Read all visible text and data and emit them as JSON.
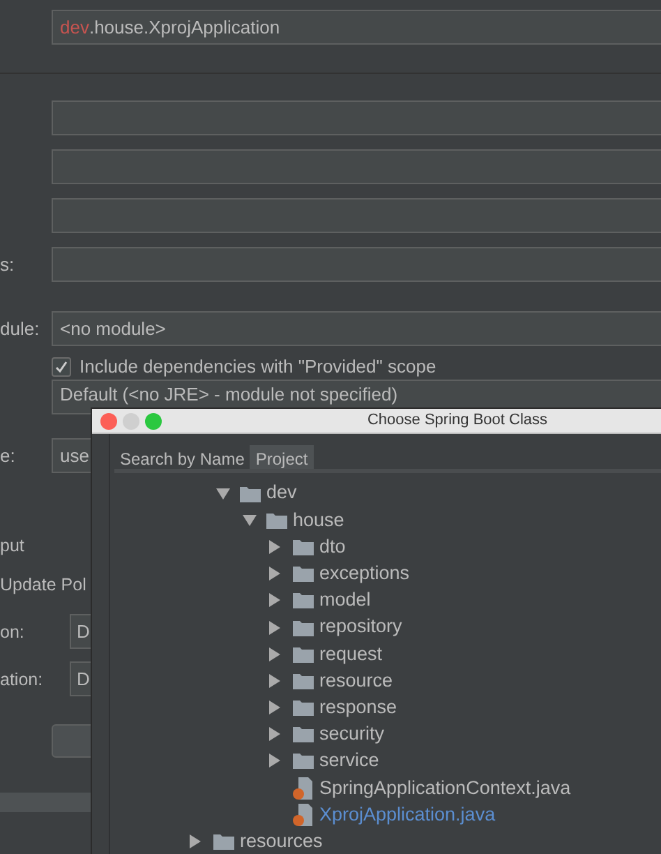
{
  "form": {
    "main_class": {
      "value": "**dev**.house.XprojApplication"
    },
    "fields": [
      {
        "kind": "text"
      },
      {
        "kind": "text"
      },
      {
        "kind": "text"
      },
      {
        "kind": "text",
        "label": "s:"
      }
    ],
    "module": {
      "label": "dule:",
      "value": "<no module>"
    },
    "include_provided": {
      "label": "Include dependencies with \"Provided\" scope",
      "checked": true
    },
    "jre": {
      "value": "Default (<no JRE> - module not specified)"
    },
    "shorten": {
      "label": "e:",
      "value": "use"
    },
    "lower_labels": [
      {
        "label": "put"
      },
      {
        "label": "Update Pol"
      },
      {
        "label": "on:",
        "value": "D"
      },
      {
        "label": "ation:",
        "value": "D"
      }
    ]
  },
  "dialog": {
    "title": "Choose Spring Boot Class",
    "tabs": [
      {
        "label": "Search by Name",
        "selected": false
      },
      {
        "label": "Project",
        "selected": true
      }
    ],
    "tree": [
      {
        "label": "dev",
        "kind": "folder",
        "expanded": true,
        "selected": false,
        "children": [
          {
            "label": "house",
            "kind": "folder",
            "expanded": true,
            "selected": false,
            "children": [
              {
                "label": "dto",
                "kind": "folder",
                "expanded": false,
                "selected": false
              },
              {
                "label": "exceptions",
                "kind": "folder",
                "expanded": false,
                "selected": false
              },
              {
                "label": "model",
                "kind": "folder",
                "expanded": false,
                "selected": false
              },
              {
                "label": "repository",
                "kind": "folder",
                "expanded": false,
                "selected": false
              },
              {
                "label": "request",
                "kind": "folder",
                "expanded": false,
                "selected": false
              },
              {
                "label": "resource",
                "kind": "folder",
                "expanded": false,
                "selected": false
              },
              {
                "label": "response",
                "kind": "folder",
                "expanded": false,
                "selected": false
              },
              {
                "label": "security",
                "kind": "folder",
                "expanded": false,
                "selected": false
              },
              {
                "label": "service",
                "kind": "folder",
                "expanded": false,
                "selected": false
              },
              {
                "label": "SpringApplicationContext.java",
                "kind": "file",
                "selected": false
              },
              {
                "label": "XprojApplication.java",
                "kind": "file",
                "selected": true
              }
            ]
          }
        ]
      }
    ],
    "tree_outer": [
      {
        "label": "resources",
        "kind": "folder",
        "expanded": false,
        "selected": false
      }
    ]
  }
}
